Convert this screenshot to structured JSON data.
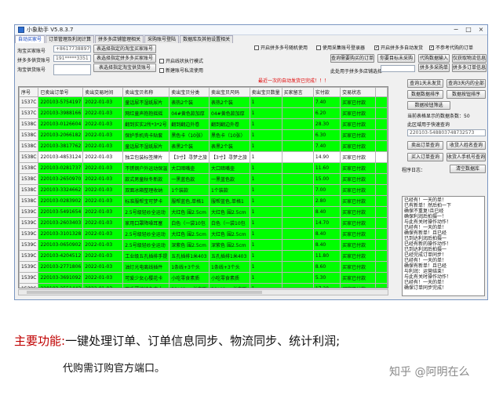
{
  "window": {
    "title": "小象助手 V5.8.3.7",
    "controls": [
      "−",
      "□",
      "×"
    ]
  },
  "tabs": [
    "自动买家号",
    "订单管理及利润计算",
    "拼多多店铺管理相关",
    "采购账号登陆",
    "数据库及其他设置相关"
  ],
  "form": {
    "buyer_label": "淘宝买家账号",
    "buyer_value": "+8617738897971",
    "pdd_label": "拼多多供货账号",
    "pdd_value": "191*****3351",
    "sub_label": "淘宝供货账号",
    "sub_value": "",
    "btn_set_taobao": "表选择指定的淘宝买家账号",
    "btn_set_pdd": "表选择指定拼多多买家账号",
    "btn_set_sub": "表选择指定淘宝供货账号"
  },
  "options": {
    "auto_proxy": "开启拼多多号随机使用",
    "use_pdd_login": "使用采集账号登录器",
    "auto_pay": "开启拼多多自动发货",
    "no_ref_limit": "不参考代购的订单",
    "open_auto_mode": "开启线状执行模式",
    "new_window_mode": "新建账号私流使用",
    "status_message": "最近一次的自动发货已完成！！！"
  },
  "buttons": {
    "query_today": "查询需要购买的订单",
    "export_unsent": "你要目标未采购",
    "import_tracking": "代购数据输入",
    "fetch_logistics": "仅获取物流信息",
    "import_purchase": "拼多多采购单",
    "import_sale": "拼多多订单信息",
    "query_1day": "查询1天未发货",
    "query_3day": "查询3天内的全部",
    "data_sort": "数据数据排序",
    "data_sort_b": "数据按钮排序",
    "data_filter": "数据按钮筛选",
    "sale_order": "卖出订单查询",
    "buyer_search": "收货人姓名查询",
    "buyer_order": "买入订单查询",
    "phone_search": "收货人手机号查询",
    "clear_log": "清空数据库"
  },
  "dropdown": {
    "label": "此处用于拼多多店铺选择",
    "value": ""
  },
  "status_lines": [
    "当前表格显示的数据条数：50",
    "此区域用于快速查询",
    "220103-548803748732573"
  ],
  "table": {
    "headers": [
      "序号",
      "已卖出订单号",
      "卖出交易时间",
      "卖出宝贝名称",
      "卖出宝贝分类",
      "卖出宝贝尺码",
      "卖出宝贝数量",
      "买家留言",
      "实付款",
      "交易状态",
      ""
    ],
    "rows": [
      {
        "n": "1537C",
        "id": "220103-5754197",
        "date": "2022-01-03",
        "name": "童话尿不湿纸尿片",
        "cls": "表热2个装",
        "size": "表热2个装",
        "qty": "1",
        "msg": "",
        "price": "7.40",
        "status": "买家已付款",
        "hl": true
      },
      {
        "n": "1537C",
        "id": "220103-3988166",
        "date": "2022-01-03",
        "name": "网红童声抱抱摇摇",
        "cls": "04#黄色款加厚",
        "size": "04#黄色款加厚",
        "qty": "1",
        "msg": "",
        "price": "6.20",
        "status": "买家已付款",
        "hl": true
      },
      {
        "n": "1538C",
        "id": "220103-0126604",
        "date": "2022-01-03",
        "name": "翻到实实2所*3*2号",
        "cls": "翻到翻边外卷",
        "size": "翻到翻边外卷",
        "qty": "1",
        "msg": "",
        "price": "28.30",
        "status": "买家已付款",
        "hl": true
      },
      {
        "n": "1538C",
        "id": "220103-2066182",
        "date": "2022-01-03",
        "name": "保护手机壳卡贴套",
        "cls": "黑色卡（10张）",
        "size": "黑色卡（10张）",
        "qty": "1",
        "msg": "",
        "price": "6.30",
        "status": "买家已付款",
        "hl": true
      },
      {
        "n": "1538C",
        "id": "220103-3817762",
        "date": "2022-01-03",
        "name": "童话尿不湿纸尿片",
        "cls": "表黑2个装",
        "size": "表黑2个装",
        "qty": "1",
        "msg": "",
        "price": "7.40",
        "status": "买家已付款",
        "hl": true
      },
      {
        "n": "1538C",
        "id": "220103-4853124",
        "date": "2022-01-03",
        "name": "独立包装标签牌片",
        "cls": "【3寸】寻梦之旅",
        "size": "【3寸】寻梦之旅",
        "qty": "1",
        "msg": "",
        "price": "14.90",
        "status": "买家已付款",
        "hl": false
      },
      {
        "n": "1538C",
        "id": "220103-0281737",
        "date": "2022-01-03",
        "name": "不锈钢户外运动保温",
        "cls": "大口暗嘴壶",
        "size": "大口暗嘴壶",
        "qty": "1",
        "msg": "",
        "price": "11.60",
        "status": "买家已付款",
        "hl": true
      },
      {
        "n": "1538C",
        "id": "220103-2650970",
        "date": "2022-01-03",
        "name": "款式男童秋冬新款",
        "cls": "一黑蓝色款",
        "size": "一黑蓝色款",
        "qty": "1",
        "msg": "",
        "price": "15.00",
        "status": "买家已付款",
        "hl": true
      },
      {
        "n": "1538C",
        "id": "220103-3324662",
        "date": "2022-01-03",
        "name": "双面冰箱整理收纳",
        "cls": "1个装款",
        "size": "1个装款",
        "qty": "1",
        "msg": "",
        "price": "7.00",
        "status": "买家已付款",
        "hl": true
      },
      {
        "n": "1538C",
        "id": "220103-0283902",
        "date": "2022-01-03",
        "name": "标准服帮宝可梦卡",
        "cls": "服帮蓝色,单格1",
        "size": "服帮蓝色,单格1",
        "qty": "1",
        "msg": "",
        "price": "2.80",
        "status": "买家已付款",
        "hl": true
      },
      {
        "n": "1539C",
        "id": "220103-5491654",
        "date": "2022-01-03",
        "name": "2.5号级轻纱全运动",
        "cls": "大红色 围2.5cm",
        "size": "大红色 围2.5cm",
        "qty": "1",
        "msg": "",
        "price": "8.40",
        "status": "买家已付款",
        "hl": true
      },
      {
        "n": "1539C",
        "id": "220103-2603403",
        "date": "2022-01-03",
        "name": "家用口罩降噪耳塞",
        "cls": "白色（一袋10包",
        "size": "白色（一袋10包",
        "qty": "1",
        "msg": "",
        "price": "14.70",
        "status": "买家已付款",
        "hl": true
      },
      {
        "n": "1539C",
        "id": "220103-3101328",
        "date": "2022-01-03",
        "name": "2.5号级轻纱全运动",
        "cls": "大红色 围2.5cm",
        "size": "大红色 围2.5cm",
        "qty": "1",
        "msg": "",
        "price": "8.40",
        "status": "买家已付款",
        "hl": true
      },
      {
        "n": "1539C",
        "id": "220103-0650902",
        "date": "2022-01-03",
        "name": "2.5号级轻纱全运动",
        "cls": "深紫色 围2.5cm",
        "size": "深紫色 围2.5cm",
        "qty": "1",
        "msg": "",
        "price": "8.40",
        "status": "买家已付款",
        "hl": true
      },
      {
        "n": "1539C",
        "id": "220103-4204512",
        "date": "2022-01-03",
        "name": "工业级五孔插排手提",
        "cls": "五孔插排1米403",
        "size": "五孔插排1米403",
        "qty": "1",
        "msg": "",
        "price": "11.80",
        "status": "买家已付款",
        "hl": true
      },
      {
        "n": "1539C",
        "id": "220103-2771806",
        "date": "2022-01-03",
        "name": "油灯光电离线插件",
        "cls": "1条线+3个头",
        "size": "1条线+3个头",
        "qty": "1",
        "msg": "",
        "price": "8.60",
        "status": "买家已付款",
        "hl": true
      },
      {
        "n": "1539C",
        "id": "220103-3691092",
        "date": "2022-01-03",
        "name": "可爱少女心樱花卡",
        "cls": "小吃零食素质",
        "size": "小吃零食素质",
        "qty": "1",
        "msg": "",
        "price": "5.30",
        "status": "买家已付款",
        "hl": true
      },
      {
        "n": "1539C",
        "id": "220103-2551443",
        "date": "2022-01-03",
        "name": "四季薄棉纯色方巾",
        "cls": "30*40cm长方形",
        "size": "30*40cm长方形",
        "qty": "1",
        "msg": "",
        "price": "17.20",
        "status": "买家已付款",
        "hl": true
      }
    ]
  },
  "log": {
    "label": "程序日志：",
    "lines": [
      "已经有！一天的单！",
      "已有新单！然后拍一下",
      "确保不重复!且已经",
      "确保利润后拍摄一！",
      "与此有关时操作动作！",
      "已经有！一天的单！",
      "确保有新单！且已经",
      "已到达利润后拍摄一",
      "已经有新的操作动作！",
      "已到达利润后拍摄一",
      "已经完成订单同步！",
      "已经有！一天的单！",
      "确保有新单！且已经",
      "与利润：运营结束！",
      "与此有关时操作动作！",
      "已经有！一天的单！",
      "确保订单同步完成！"
    ]
  },
  "caption": {
    "highlight": "主要功能:",
    "line1": "主要功能:一键处理订单、订单信息同步、物流同步、统计利润;",
    "line2": "代购需订购官方端口。"
  },
  "watermark": "知乎 @阿明在么"
}
